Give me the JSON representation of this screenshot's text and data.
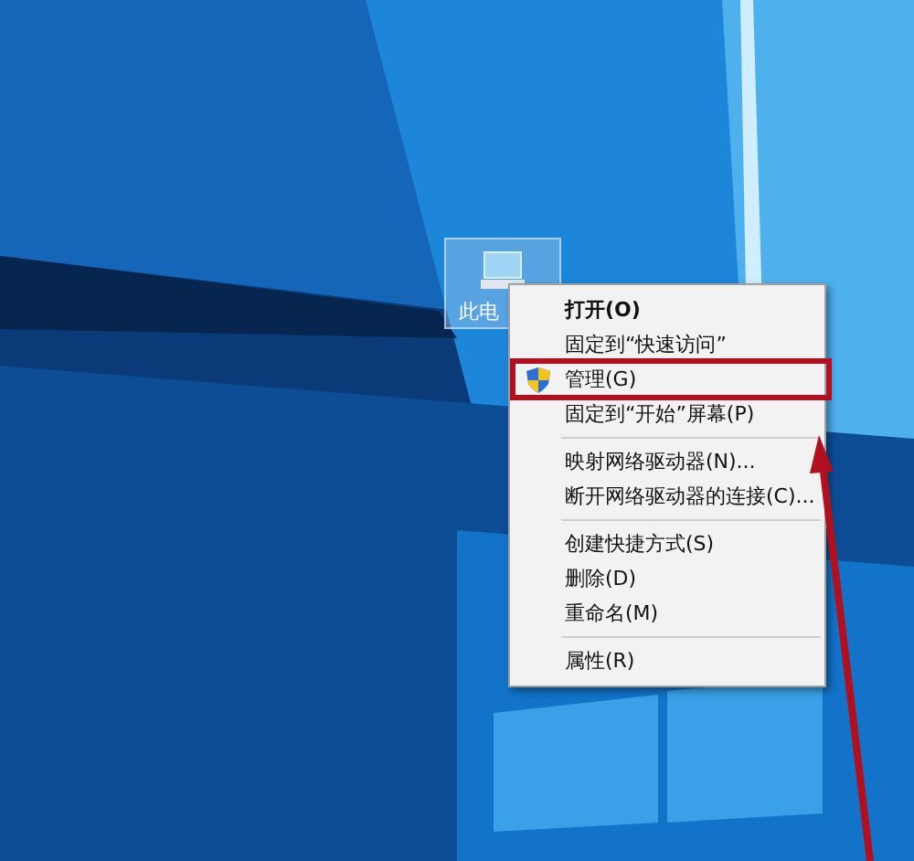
{
  "desktop_icon": {
    "label": "此电",
    "selected": true
  },
  "context_menu": {
    "items": [
      {
        "kind": "item",
        "label": "打开(O)",
        "bold": true,
        "icon": false,
        "highlighted": false
      },
      {
        "kind": "item",
        "label": "固定到“快速访问”",
        "bold": false,
        "icon": false,
        "highlighted": false
      },
      {
        "kind": "item",
        "label": "管理(G)",
        "bold": false,
        "icon": true,
        "highlighted": true
      },
      {
        "kind": "item",
        "label": "固定到“开始”屏幕(P)",
        "bold": false,
        "icon": false,
        "highlighted": false
      },
      {
        "kind": "separator"
      },
      {
        "kind": "item",
        "label": "映射网络驱动器(N)...",
        "bold": false,
        "icon": false,
        "highlighted": false
      },
      {
        "kind": "item",
        "label": "断开网络驱动器的连接(C)...",
        "bold": false,
        "icon": false,
        "highlighted": false
      },
      {
        "kind": "separator"
      },
      {
        "kind": "item",
        "label": "创建快捷方式(S)",
        "bold": false,
        "icon": false,
        "highlighted": false
      },
      {
        "kind": "item",
        "label": "删除(D)",
        "bold": false,
        "icon": false,
        "highlighted": false
      },
      {
        "kind": "item",
        "label": "重命名(M)",
        "bold": false,
        "icon": false,
        "highlighted": false
      },
      {
        "kind": "separator"
      },
      {
        "kind": "item",
        "label": "属性(R)",
        "bold": false,
        "icon": false,
        "highlighted": false
      }
    ]
  }
}
